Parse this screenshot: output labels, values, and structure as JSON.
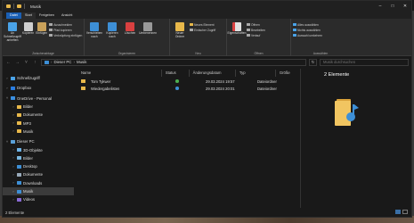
{
  "window": {
    "title": "Musik"
  },
  "tabs": [
    {
      "label": "Datei"
    },
    {
      "label": "Start"
    },
    {
      "label": "Freigeben"
    },
    {
      "label": "Ansicht"
    }
  ],
  "ribbon": {
    "clipboard": {
      "pin_label": "An Schnellzugriff anheften",
      "copy_label": "Kopieren",
      "paste_label": "Einfügen",
      "cut_label": "Ausschneiden",
      "copy_path_label": "Pfad kopieren",
      "paste_shortcut_label": "Verknüpfung einfügen",
      "group_label": "Zwischenablage"
    },
    "organize": {
      "move_label": "Verschieben nach",
      "copy_to_label": "Kopieren nach",
      "delete_label": "Löschen",
      "rename_label": "Umbenennen",
      "group_label": "Organisieren"
    },
    "new": {
      "new_folder_label": "Neuer Ordner",
      "new_item_label": "Neues Element",
      "easy_access_label": "Einfacher Zugriff",
      "group_label": "Neu"
    },
    "open": {
      "properties_label": "Eigenschaften",
      "open_label": "Öffnen",
      "edit_label": "Bearbeiten",
      "history_label": "Verlauf",
      "group_label": "Öffnen"
    },
    "select": {
      "select_all_label": "Alles auswählen",
      "select_none_label": "Nichts auswählen",
      "invert_label": "Auswahl umkehren",
      "group_label": "Auswählen"
    }
  },
  "address": {
    "path": [
      "Dieser PC",
      "Musik"
    ],
    "search_placeholder": "Musik durchsuchen"
  },
  "sidebar": {
    "items": [
      {
        "label": "Schnellzugriff",
        "icon": "star-icon",
        "color": "#4aa3e8"
      },
      {
        "label": "Dropbox",
        "icon": "dropbox-icon",
        "color": "#2a7de1"
      },
      {
        "label": "OneDrive - Personal",
        "icon": "cloud-icon",
        "color": "#3b8fe0"
      },
      {
        "label": "Bilder",
        "icon": "folder-icon",
        "color": "#e8b84a"
      },
      {
        "label": "Dokumente",
        "icon": "folder-icon",
        "color": "#e8b84a"
      },
      {
        "label": "MP3",
        "icon": "folder-icon",
        "color": "#e8b84a"
      },
      {
        "label": "Musik",
        "icon": "folder-icon",
        "color": "#e8b84a"
      },
      {
        "label": "Dieser PC",
        "icon": "computer-icon",
        "color": "#5aa0d8"
      },
      {
        "label": "3D-Objekte",
        "icon": "cube-icon",
        "color": "#6db3e8"
      },
      {
        "label": "Bilder",
        "icon": "pictures-icon",
        "color": "#7ab8e0"
      },
      {
        "label": "Desktop",
        "icon": "desktop-icon",
        "color": "#3d8fd6"
      },
      {
        "label": "Dokumente",
        "icon": "documents-icon",
        "color": "#9ab"
      },
      {
        "label": "Downloads",
        "icon": "download-icon",
        "color": "#3d8fd6"
      },
      {
        "label": "Musik",
        "icon": "music-icon",
        "color": "#3d8fd6"
      },
      {
        "label": "Videos",
        "icon": "video-icon",
        "color": "#8a6bd6"
      }
    ]
  },
  "columns": {
    "name": "Name",
    "status": "Status",
    "date": "Änderungsdatum",
    "type": "Typ",
    "size": "Größe"
  },
  "files": [
    {
      "name": "Tom Tykwer",
      "status_color": "#4caf50",
      "date": "29.03.2024 19:57",
      "type": "Dateiordner"
    },
    {
      "name": "Wiedergabelisten",
      "status_color": "#3d8fd6",
      "date": "29.03.2024 20:01",
      "type": "Dateiordner"
    }
  ],
  "preview": {
    "title": "2 Elemente"
  },
  "status": {
    "count": "2 Elemente"
  }
}
